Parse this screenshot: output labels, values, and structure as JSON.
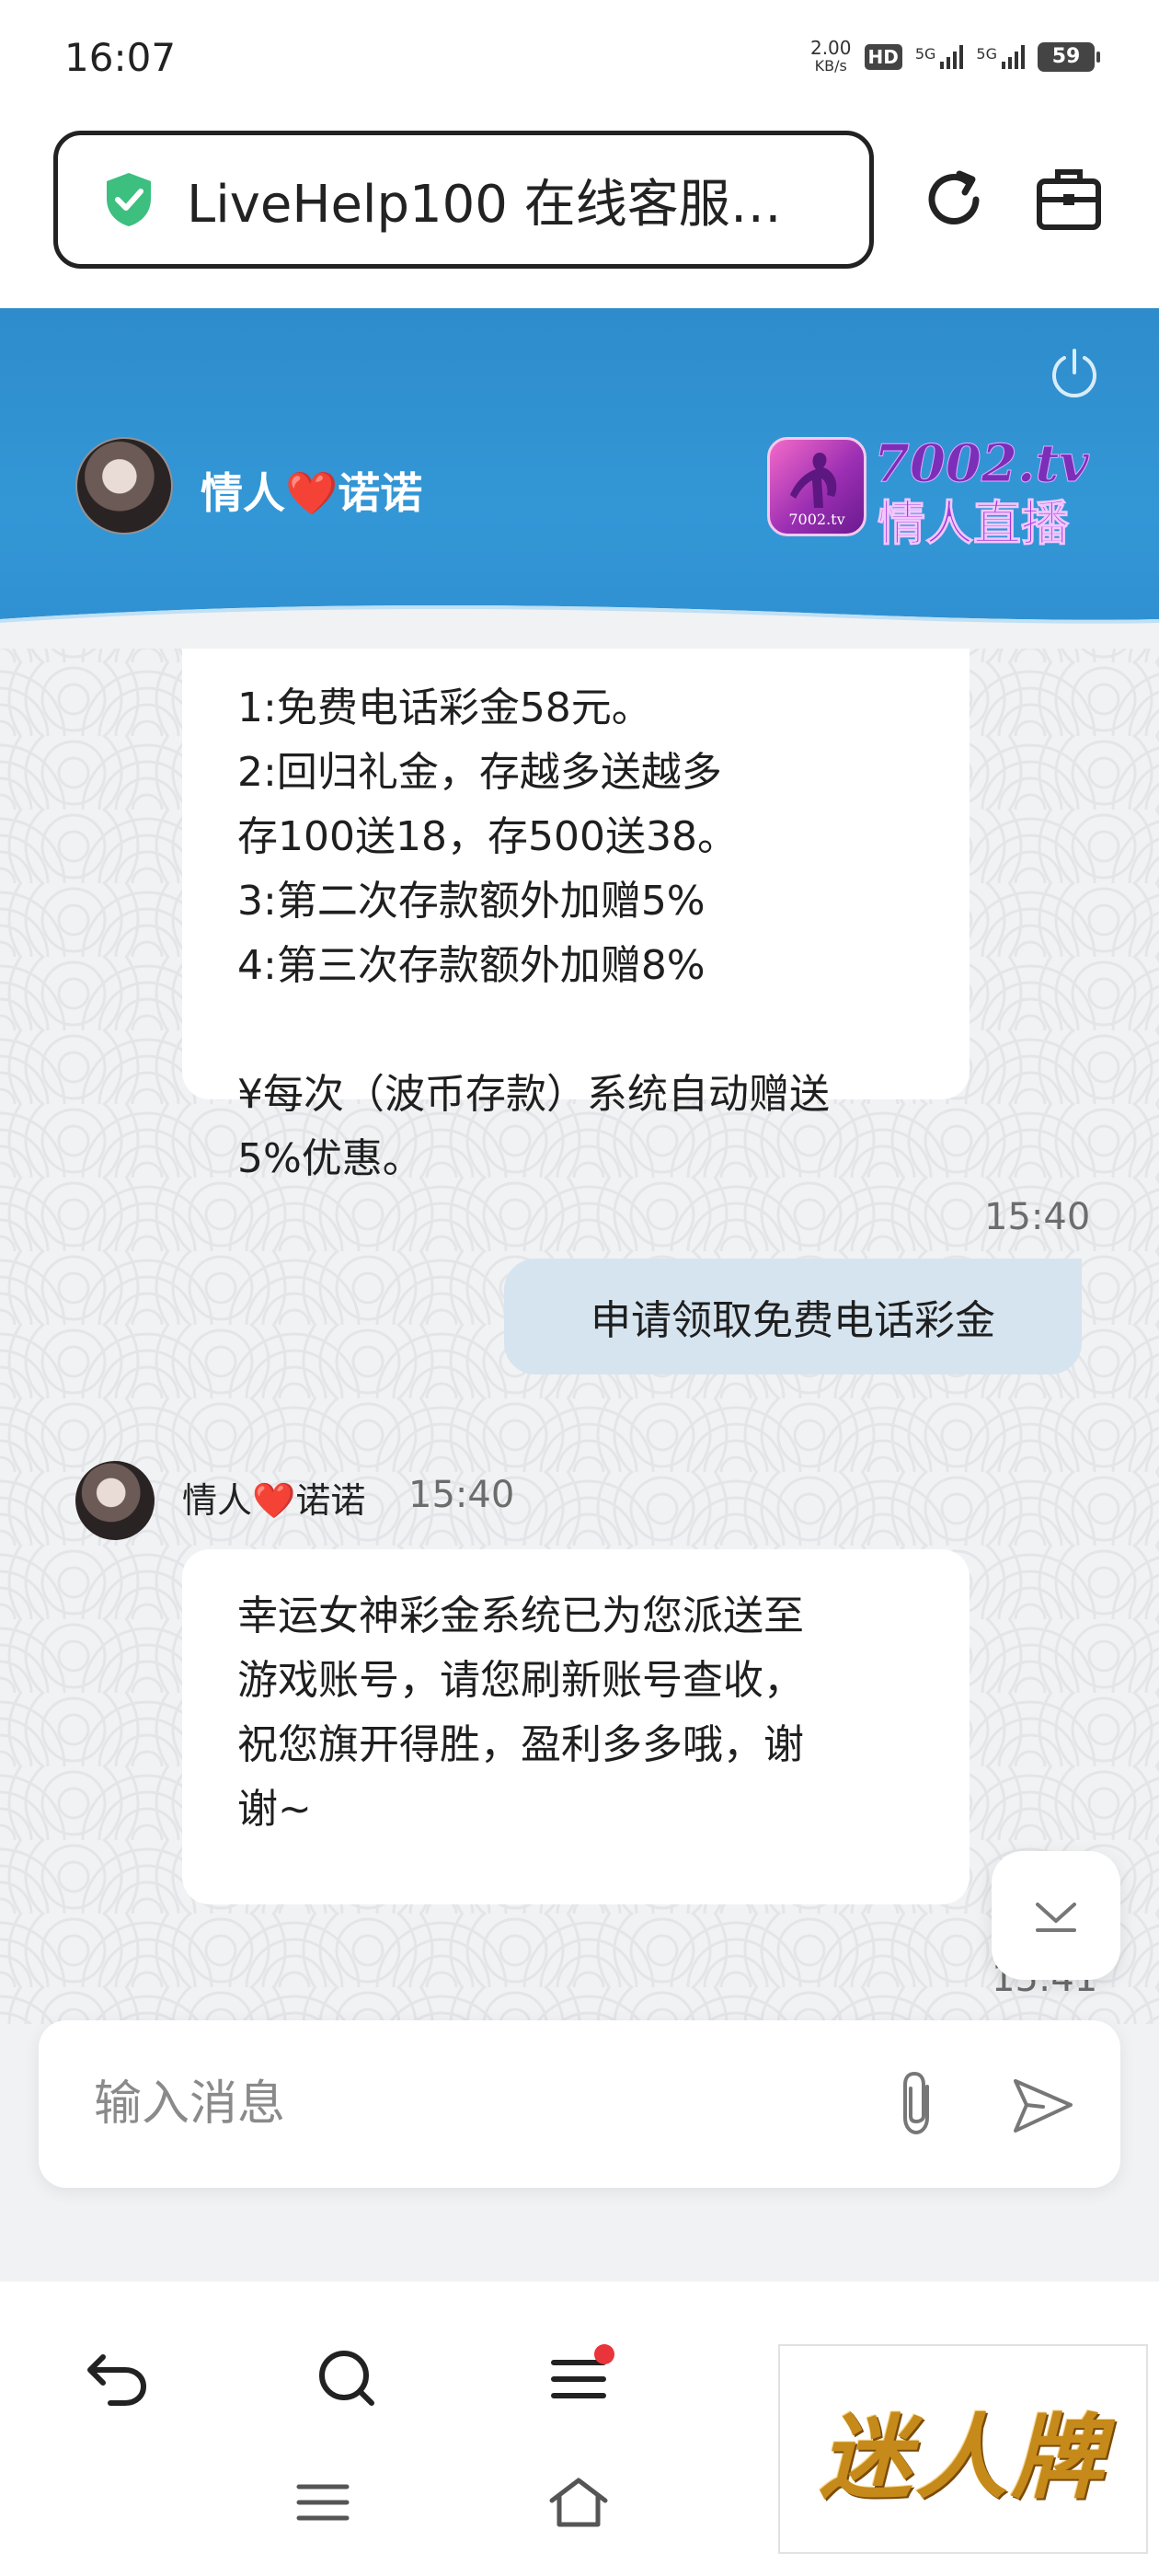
{
  "status_bar": {
    "time": "16:07",
    "net_speed_value": "2.00",
    "net_speed_unit": "KB/s",
    "hd_label": "HD",
    "sim1_label": "5G",
    "sim2_label": "5G",
    "battery": "59"
  },
  "browser": {
    "url_title": "LiveHelp100 在线客服…"
  },
  "chat_header": {
    "agent_name_part1": "情人",
    "agent_name_heart": "❤️",
    "agent_name_part2": "诺诺",
    "logo_badge_text": "7002.tv",
    "logo_domain": "7002.tv",
    "logo_cn": "情人直播"
  },
  "messages": {
    "first_bubble_lines": [
      "1:免费电话彩金58元。",
      "2:回归礼金，存越多送越多",
      "存100送18，存500送38。",
      "3:第二次存款额外加赠5%",
      "4:第三次存款额外加赠8%",
      "",
      "¥每次（波币存款）系统自动赠送",
      "5%优惠。"
    ],
    "user_time": "15:40",
    "user_message": "申请领取免费电话彩金",
    "agent_name": "情人❤️诺诺",
    "agent_time": "15:40",
    "agent_reply": "幸运女神彩金系统已为您派送至\n游戏账号，请您刷新账号查收，\n祝您旗开得胜，盈利多多哦，谢\n谢~",
    "next_time": "15:41"
  },
  "input": {
    "placeholder": "输入消息"
  },
  "watermark": {
    "text": "迷人牌"
  },
  "colors": {
    "header_blue": "#2e8ccc",
    "user_bubble": "#d6e4ef",
    "notify_dot": "#e8343a",
    "shield_green": "#3cbf7f"
  }
}
